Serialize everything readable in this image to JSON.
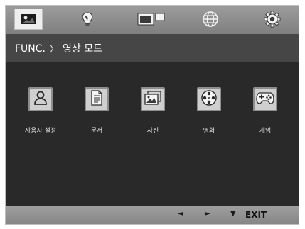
{
  "tabs": [
    {
      "name": "picture-tab",
      "icon": "picture-icon",
      "active": true
    },
    {
      "name": "eco-tab",
      "icon": "leaf-bulb-icon",
      "active": false
    },
    {
      "name": "screen-tab",
      "icon": "screen-layout-icon",
      "active": false
    },
    {
      "name": "language-tab",
      "icon": "globe-icon",
      "active": false
    },
    {
      "name": "settings-tab",
      "icon": "gear-icon",
      "active": false
    }
  ],
  "header": {
    "func_label": "FUNC.",
    "separator": "〉",
    "title": "영상 모드"
  },
  "modes": [
    {
      "label": "사용자 설정",
      "icon": "user-icon"
    },
    {
      "label": "문서",
      "icon": "document-icon"
    },
    {
      "label": "사진",
      "icon": "photo-icon"
    },
    {
      "label": "영화",
      "icon": "film-reel-icon"
    },
    {
      "label": "게임",
      "icon": "gamepad-icon"
    }
  ],
  "footer": {
    "left_arrow": "◄",
    "right_arrow": "►",
    "down_arrow": "▼",
    "exit_label": "EXIT"
  },
  "colors": {
    "background": "#292929",
    "tab_bar": "#8f8f8f",
    "header": "#464646",
    "icon_tile": "#cfcfcf"
  }
}
